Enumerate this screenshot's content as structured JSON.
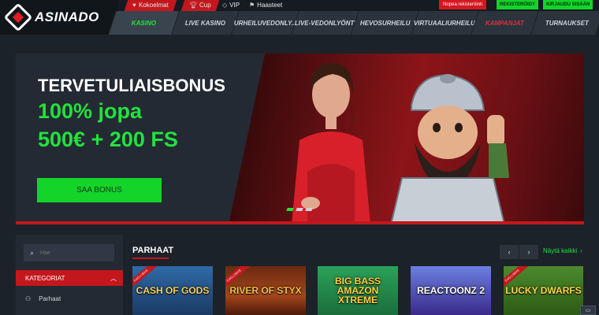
{
  "brand": {
    "logo_text": "ASINADO"
  },
  "topbar": {
    "links": [
      {
        "label": "Kokoelmat",
        "icon": "heart-icon"
      },
      {
        "label": "Cup",
        "icon": "trophy-icon"
      },
      {
        "label": "VIP",
        "icon": "diamond-icon"
      },
      {
        "label": "Haasteet",
        "icon": "flag-icon"
      }
    ],
    "quick_register": "Nopea rekisteröinti",
    "register": "REKISTERÖIDY",
    "login": "KIRJAUDU SISÄÄN"
  },
  "nav": {
    "items": [
      {
        "label": "KASINO",
        "state": "active"
      },
      {
        "label": "LIVE KASINO"
      },
      {
        "label": "URHEILUVEDONLY..."
      },
      {
        "label": "LIVE-VEDONLYÖNTI"
      },
      {
        "label": "HEVOSURHEILU"
      },
      {
        "label": "VIRTUAALIURHEILU"
      },
      {
        "label": "KAMPANJAT",
        "state": "promo"
      },
      {
        "label": "TURNAUKSET"
      }
    ]
  },
  "banner": {
    "title": "TERVETULIAISBONUS",
    "line1": "100% jopa",
    "line2": "500€ + 200 FS",
    "cta": "SAA BONUS",
    "slides_total": 3,
    "active_slide": 1
  },
  "sidebar": {
    "search_placeholder": "Hae",
    "categories_label": "KATEGORIAT",
    "items": [
      {
        "label": "Parhaat",
        "icon": "controller-icon"
      }
    ]
  },
  "games": {
    "section_title": "PARHAAT",
    "see_all": "Näytä kaikki",
    "badge": "EXCLUSIVE",
    "tiles": [
      {
        "name": "CASH OF GODS",
        "exclusive": true
      },
      {
        "name": "RIVER OF STYX",
        "exclusive": true
      },
      {
        "name": "BIG BASS AMAZON XTREME",
        "exclusive": false
      },
      {
        "name": "REACTOONZ 2",
        "exclusive": false
      },
      {
        "name": "LUCKY DWARFS",
        "exclusive": true
      }
    ]
  },
  "colors": {
    "accent_green": "#22e23c",
    "accent_red": "#c3171d",
    "background": "#1c2229"
  }
}
